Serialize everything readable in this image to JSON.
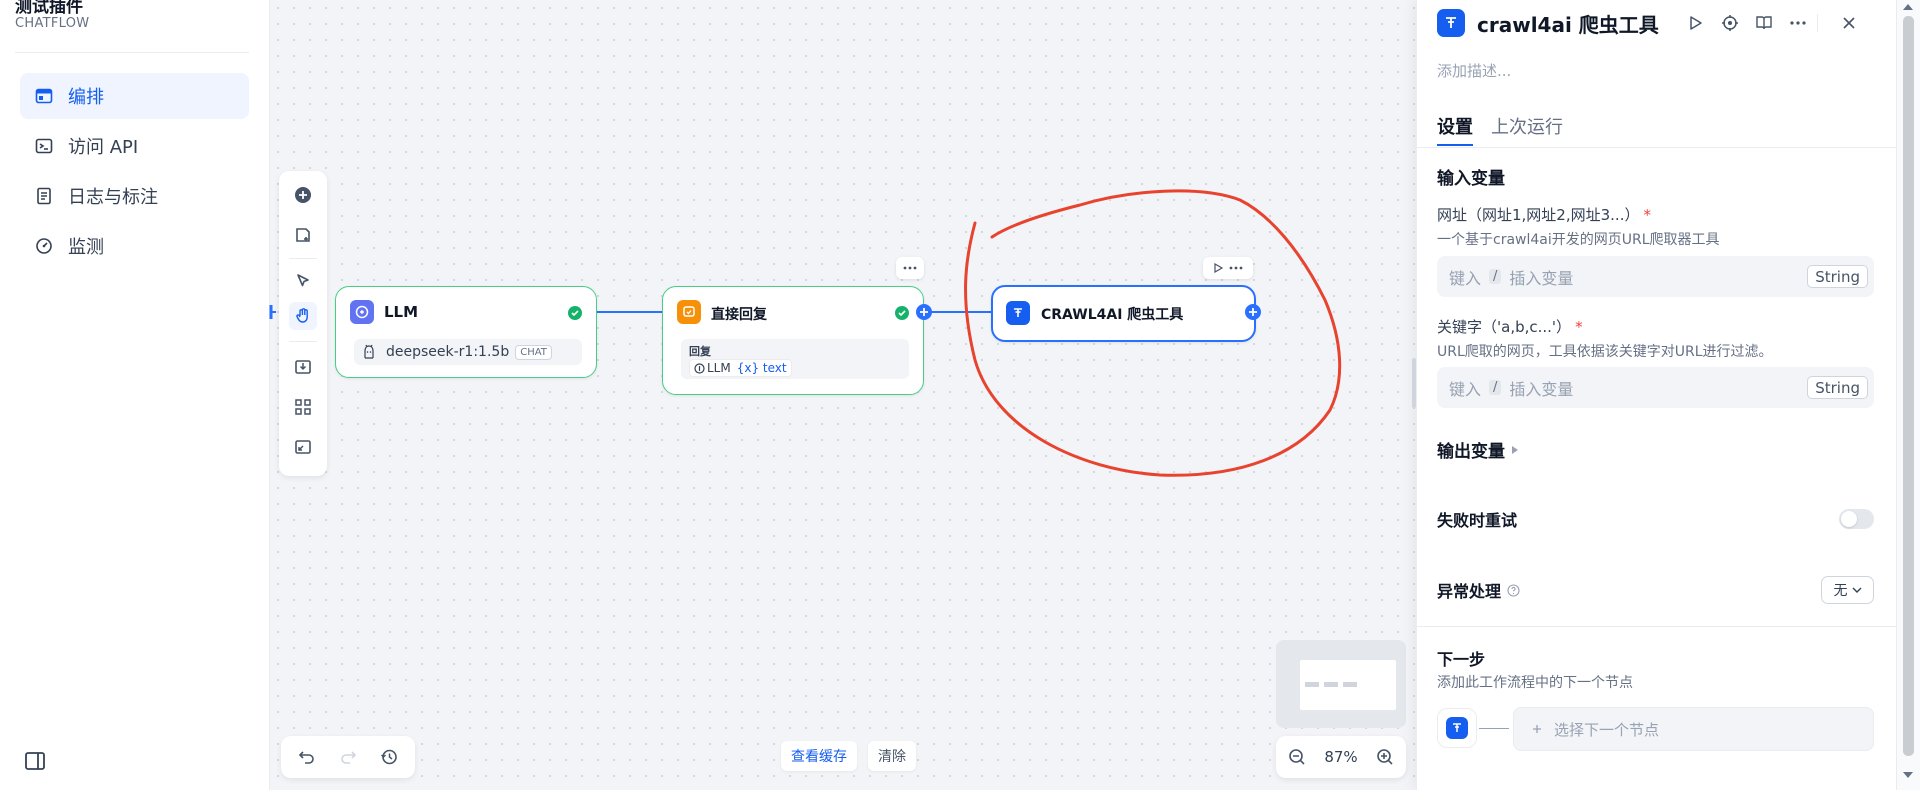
{
  "app": {
    "title": "测试插件",
    "subtitle": "CHATFLOW"
  },
  "sidebar": {
    "items": [
      {
        "label": "编排",
        "icon": "layout-icon",
        "active": true
      },
      {
        "label": "访问 API",
        "icon": "terminal-icon",
        "active": false
      },
      {
        "label": "日志与标注",
        "icon": "log-icon",
        "active": false
      },
      {
        "label": "监测",
        "icon": "gauge-icon",
        "active": false
      }
    ]
  },
  "canvas": {
    "toolbar": [
      "add-node-icon",
      "add-note-icon",
      "pointer-icon",
      "hand-icon",
      "export-icon",
      "organize-icon",
      "maximize-icon"
    ],
    "nodes": {
      "llm": {
        "title": "LLM",
        "model": "deepseek-r1:1.5b",
        "mode_badge": "CHAT",
        "status": "success"
      },
      "reply": {
        "title": "直接回复",
        "label": "回复",
        "source": "LLM",
        "var": "{x} text",
        "status": "success"
      },
      "crawl": {
        "title": "CRAWL4AI 爬虫工具"
      }
    },
    "bottom": {
      "view_cache": "查看缓存",
      "clear": "清除"
    },
    "zoom": "87%",
    "colors": {
      "accent": "#155eef",
      "success": "#17b26a",
      "annotation": "#e8432e"
    }
  },
  "panel": {
    "title": "crawl4ai 爬虫工具",
    "desc_placeholder": "添加描述...",
    "tabs": [
      {
        "label": "设置",
        "active": true
      },
      {
        "label": "上次运行",
        "active": false
      }
    ],
    "input_section": "输入变量",
    "fields": [
      {
        "label": "网址（网址1,网址2,网址3...）",
        "required": "*",
        "hint": "一个基于crawl4ai开发的网页URL爬取器工具",
        "placeholder_pre": "键入",
        "slash": "/",
        "placeholder_post": "插入变量",
        "type": "String"
      },
      {
        "label": "关键字（'a,b,c...'）",
        "required": "*",
        "hint": "URL爬取的网页，工具依据该关键字对URL进行过滤。",
        "placeholder_pre": "键入",
        "slash": "/",
        "placeholder_post": "插入变量",
        "type": "String"
      }
    ],
    "output_section": "输出变量",
    "retry_label": "失败时重试",
    "retry_enabled": false,
    "error_label": "异常处理",
    "error_value": "无",
    "next": {
      "title": "下一步",
      "hint": "添加此工作流程中的下一个节点",
      "select": "选择下一个节点"
    }
  }
}
